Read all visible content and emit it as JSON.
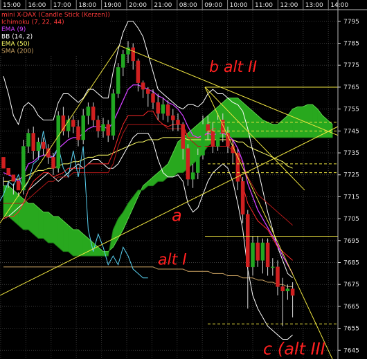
{
  "chart_data": {
    "type": "candlestick",
    "title": "mini X-DAX (Candle Stick (Kerzen))",
    "x_ticks": [
      "15:00",
      "16:00",
      "17:00",
      "18:00",
      "19:00",
      "20:00",
      "21:00",
      "08:00",
      "09:00",
      "10:00",
      "11:00",
      "12:00",
      "13:00",
      "14:00"
    ],
    "y_ticks": [
      7795,
      7785,
      7775,
      7765,
      7755,
      7745,
      7735,
      7725,
      7715,
      7705,
      7695,
      7685,
      7675,
      7665,
      7655,
      7645
    ],
    "ylim": [
      7641,
      7800
    ],
    "grid": true,
    "legend": [
      {
        "label": "mini X-DAX (Candle Stick (Kerzen))",
        "color": "#ff3b3b"
      },
      {
        "label": "Ichimoku (7, 22, 44)",
        "color": "#ff3b3b"
      },
      {
        "label": "EMA (9)",
        "color": "#d040ff"
      },
      {
        "label": "BB (14, 2)",
        "color": "#ffffff"
      },
      {
        "label": "EMA (50)",
        "color": "#ffff66"
      },
      {
        "label": "SMA (200)",
        "color": "#c8a060"
      }
    ],
    "candles": [
      [
        7733,
        7728,
        7724,
        7720
      ],
      [
        7728,
        7725,
        7722,
        7719
      ],
      [
        7725,
        7722,
        7721,
        7716
      ],
      [
        7722,
        7718,
        7717,
        7715
      ],
      [
        7718,
        7738,
        7741,
        7716
      ],
      [
        7738,
        7744,
        7746,
        7735
      ],
      [
        7744,
        7736,
        7747,
        7732
      ],
      [
        7736,
        7740,
        7742,
        7733
      ],
      [
        7740,
        7737,
        7742,
        7734
      ],
      [
        7737,
        7733,
        7739,
        7730
      ],
      [
        7733,
        7728,
        7735,
        7725
      ],
      [
        7728,
        7752,
        7754,
        7726
      ],
      [
        7752,
        7745,
        7756,
        7743
      ],
      [
        7745,
        7750,
        7752,
        7742
      ],
      [
        7750,
        7747,
        7752,
        7744
      ],
      [
        7747,
        7741,
        7750,
        7738
      ],
      [
        7741,
        7752,
        7755,
        7739
      ],
      [
        7752,
        7756,
        7758,
        7748
      ],
      [
        7756,
        7750,
        7758,
        7747
      ],
      [
        7750,
        7745,
        7752,
        7742
      ],
      [
        7745,
        7748,
        7751,
        7742
      ],
      [
        7748,
        7743,
        7750,
        7740
      ],
      [
        7743,
        7762,
        7764,
        7741
      ],
      [
        7762,
        7774,
        7776,
        7760
      ],
      [
        7774,
        7780,
        7782,
        7770
      ],
      [
        7780,
        7783,
        7786,
        7776
      ],
      [
        7783,
        7777,
        7785,
        7773
      ],
      [
        7777,
        7767,
        7778,
        7763
      ],
      [
        7767,
        7764,
        7768,
        7760
      ],
      [
        7764,
        7762,
        7765,
        7756
      ],
      [
        7762,
        7758,
        7764,
        7755
      ],
      [
        7758,
        7753,
        7762,
        7750
      ],
      [
        7753,
        7757,
        7760,
        7750
      ],
      [
        7757,
        7752,
        7759,
        7749
      ],
      [
        7752,
        7750,
        7755,
        7745
      ],
      [
        7750,
        7748,
        7753,
        7745
      ],
      [
        7748,
        7737,
        7749,
        7732
      ],
      [
        7737,
        7723,
        7739,
        7720
      ],
      [
        7723,
        7726,
        7730,
        7719
      ],
      [
        7726,
        7734,
        7737,
        7723
      ],
      [
        7734,
        7748,
        7752,
        7732
      ],
      [
        7748,
        7745,
        7752,
        7741
      ],
      [
        7745,
        7738,
        7749,
        7735
      ],
      [
        7738,
        7750,
        7753,
        7736
      ],
      [
        7750,
        7744,
        7753,
        7740
      ],
      [
        7744,
        7738,
        7747,
        7735
      ],
      [
        7738,
        7735,
        7741,
        7730
      ],
      [
        7735,
        7722,
        7737,
        7718
      ],
      [
        7722,
        7707,
        7724,
        7703
      ],
      [
        7707,
        7683,
        7709,
        7664
      ],
      [
        7683,
        7694,
        7697,
        7679
      ],
      [
        7694,
        7686,
        7697,
        7683
      ],
      [
        7686,
        7694,
        7696,
        7680
      ],
      [
        7694,
        7683,
        7696,
        7679
      ],
      [
        7683,
        7683,
        7687,
        7679
      ],
      [
        7683,
        7674,
        7686,
        7670
      ],
      [
        7674,
        7672,
        7678,
        7656
      ],
      [
        7672,
        7673,
        7675,
        7668
      ],
      [
        7673,
        7670,
        7676,
        7660
      ]
    ],
    "bb_upper": [
      7770,
      7762,
      7752,
      7748,
      7756,
      7758,
      7756,
      7752,
      7750,
      7750,
      7750,
      7758,
      7762,
      7762,
      7760,
      7758,
      7760,
      7764,
      7764,
      7762,
      7760,
      7760,
      7772,
      7782,
      7790,
      7795,
      7795,
      7792,
      7788,
      7780,
      7772,
      7764,
      7762,
      7760,
      7758,
      7756,
      7755,
      7757,
      7757,
      7756,
      7758,
      7762,
      7764,
      7762,
      7762,
      7760,
      7758,
      7757,
      7754,
      7746,
      7736,
      7728,
      7718,
      7708,
      7700,
      7692,
      7686,
      7680,
      7678
    ],
    "bb_lower": [
      7705,
      7706,
      7708,
      7710,
      7712,
      7718,
      7720,
      7722,
      7724,
      7726,
      7724,
      7722,
      7724,
      7726,
      7728,
      7730,
      7728,
      7730,
      7732,
      7732,
      7730,
      7728,
      7728,
      7730,
      7734,
      7738,
      7742,
      7744,
      7744,
      7744,
      7740,
      7732,
      7726,
      7724,
      7724,
      7725,
      7722,
      7712,
      7708,
      7710,
      7716,
      7722,
      7726,
      7728,
      7730,
      7728,
      7722,
      7712,
      7700,
      7682,
      7670,
      7664,
      7660,
      7656,
      7654,
      7652,
      7650,
      7650,
      7652
    ],
    "ema9": [
      7726,
      7725,
      7724,
      7722,
      7725,
      7730,
      7731,
      7733,
      7734,
      7734,
      7733,
      7737,
      7739,
      7741,
      7742,
      7742,
      7744,
      7746,
      7747,
      7747,
      7747,
      7746,
      7749,
      7754,
      7759,
      7764,
      7766,
      7766,
      7765,
      7764,
      7763,
      7761,
      7760,
      7758,
      7757,
      7755,
      7752,
      7747,
      7743,
      7742,
      7743,
      7744,
      7743,
      7744,
      7744,
      7743,
      7741,
      7737,
      7731,
      7721,
      7715,
      7709,
      7705,
      7701,
      7697,
      7693,
      7688,
      7684,
      7680
    ],
    "ema50": [
      7722,
      7722,
      7723,
      7723,
      7724,
      7725,
      7726,
      7727,
      7727,
      7728,
      7728,
      7729,
      7730,
      7730,
      7731,
      7731,
      7732,
      7733,
      7733,
      7734,
      7734,
      7734,
      7735,
      7736,
      7737,
      7738,
      7739,
      7740,
      7740,
      7741,
      7741,
      7741,
      7742,
      7742,
      7742,
      7742,
      7742,
      7741,
      7741,
      7741,
      7741,
      7741,
      7741,
      7741,
      7741,
      7741,
      7741,
      7740,
      7740,
      7738,
      7737,
      7736,
      7735,
      7734,
      7733,
      7732,
      7731,
      7729,
      7728
    ],
    "sma200": [
      7683,
      7683,
      7683,
      7683,
      7683,
      7683,
      7683,
      7683,
      7683,
      7683,
      7683,
      7683,
      7683,
      7683,
      7683,
      7683,
      7683,
      7683,
      7683,
      7683,
      7683,
      7683,
      7683,
      7683,
      7683,
      7683,
      7683,
      7683,
      7683,
      7683,
      7683,
      7682,
      7682,
      7682,
      7682,
      7682,
      7682,
      7681,
      7681,
      7681,
      7681,
      7681,
      7680,
      7680,
      7680,
      7679,
      7679,
      7679,
      7678,
      7678,
      7678,
      7677,
      7677,
      7676,
      7676,
      7675,
      7675,
      7674,
      7674
    ],
    "tenkan": [
      7705,
      7706,
      7706,
      7708,
      7712,
      7718,
      7722,
      7724,
      7726,
      7726,
      7724,
      7725,
      7726,
      7728,
      7728,
      7728,
      7728,
      7730,
      7730,
      7730,
      7730,
      7730,
      7735,
      7742,
      7748,
      7752,
      7752,
      7752,
      7752,
      7754,
      7754,
      7750,
      7748,
      7747,
      7748,
      7748,
      7748,
      7742,
      7742,
      7742,
      7742,
      7744,
      7746,
      7746,
      7746,
      7744,
      7740,
      7730,
      7720,
      7712,
      7708,
      7704,
      7702,
      7700,
      7696,
      7692,
      7690,
      7688,
      7686
    ],
    "kijun": [
      7712,
      7712,
      7712,
      7712,
      7712,
      7714,
      7716,
      7718,
      7720,
      7722,
      7722,
      7724,
      7724,
      7724,
      7726,
      7726,
      7726,
      7726,
      7726,
      7726,
      7726,
      7726,
      7730,
      7738,
      7744,
      7748,
      7748,
      7748,
      7748,
      7748,
      7748,
      7748,
      7748,
      7746,
      7746,
      7746,
      7746,
      7742,
      7740,
      7738,
      7738,
      7738,
      7738,
      7738,
      7738,
      7738,
      7736,
      7734,
      7730,
      7724,
      7720,
      7716,
      7714,
      7712,
      7710,
      7708,
      7706,
      7704,
      7702
    ],
    "chikou": [
      7700,
      7698,
      7705,
      7712,
      7716,
      7722,
      7720,
      7725,
      7718,
      7722,
      7730,
      7732,
      7745,
      7733,
      7733,
      7738,
      7728,
      7724,
      7736,
      7724,
      7738,
      7700,
      7690,
      7698,
      7692,
      7684,
      7688,
      7684,
      7692,
      7688,
      7682,
      7680,
      7678,
      7678
    ],
    "senkou_a": [
      7720,
      7720,
      7718,
      7716,
      7714,
      7712,
      7712,
      7710,
      7708,
      7708,
      7706,
      7706,
      7704,
      7702,
      7700,
      7700,
      7698,
      7696,
      7694,
      7692,
      7690,
      7690,
      7692,
      7696,
      7700,
      7705,
      7710,
      7715,
      7720,
      7722,
      7724,
      7726,
      7728,
      7730,
      7735,
      7740,
      7742,
      7744,
      7746,
      7748,
      7750,
      7752,
      7754,
      7756,
      7758,
      7760,
      7760,
      7760,
      7758,
      7756,
      7754,
      7752,
      7750,
      7749,
      7748,
      7748,
      7750,
      7752,
      7755,
      7756,
      7756,
      7757,
      7757,
      7755,
      7752,
      7750,
      7748
    ],
    "senkou_b": [
      7706,
      7706,
      7704,
      7702,
      7700,
      7700,
      7698,
      7696,
      7696,
      7694,
      7694,
      7692,
      7690,
      7690,
      7688,
      7688,
      7688,
      7688,
      7688,
      7688,
      7688,
      7688,
      7700,
      7705,
      7708,
      7712,
      7715,
      7718,
      7718,
      7720,
      7720,
      7722,
      7722,
      7724,
      7724,
      7726,
      7726,
      7728,
      7730,
      7732,
      7735,
      7738,
      7740,
      7742,
      7742,
      7742,
      7742,
      7742,
      7742,
      7742,
      7742,
      7742,
      7742,
      7742,
      7742,
      7742,
      7742,
      7742,
      7742,
      7742,
      7742,
      7742,
      7742,
      7742,
      7742,
      7742,
      7742
    ],
    "annotations": [
      "b alt II",
      "a",
      "alt I",
      "c (alt III"
    ]
  },
  "colors": {
    "up": "#22a822",
    "down": "#d02020",
    "cloud": "#28a81e",
    "bb": "#ffffff",
    "ema9": "#d040ff",
    "ema9b": "#3a3aff",
    "ema50": "#ffff66",
    "sma200": "#c8a060",
    "tenkan": "#ff2a2a",
    "chikou": "#59d0f0",
    "trend": "#f0e640",
    "handwriting": "#ff2020"
  }
}
